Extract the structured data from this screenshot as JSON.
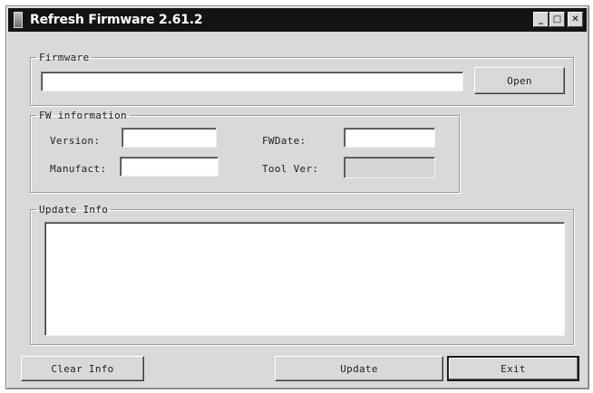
{
  "window": {
    "title": "Refresh Firmware 2.61.2",
    "controls": {
      "minimize": "_",
      "maximize": "□",
      "close": "✕"
    }
  },
  "firmware_group": {
    "legend": "Firmware",
    "path_value": "",
    "open_label": "Open"
  },
  "fw_info_group": {
    "legend": "FW information",
    "version_label": "Version:",
    "version_value": "",
    "manufact_label": "Manufact:",
    "manufact_value": "",
    "fwdate_label": "FWDate:",
    "fwdate_value": "",
    "toolver_label": "Tool Ver:",
    "toolver_value": ""
  },
  "update_group": {
    "legend": "Update Info",
    "log_text": ""
  },
  "footer": {
    "clear_label": "Clear Info",
    "update_label": "Update",
    "exit_label": "Exit"
  },
  "icons": {
    "app": "app-icon"
  },
  "colors": {
    "titlebar": "#141414",
    "window_bg": "#d9d9d9"
  }
}
